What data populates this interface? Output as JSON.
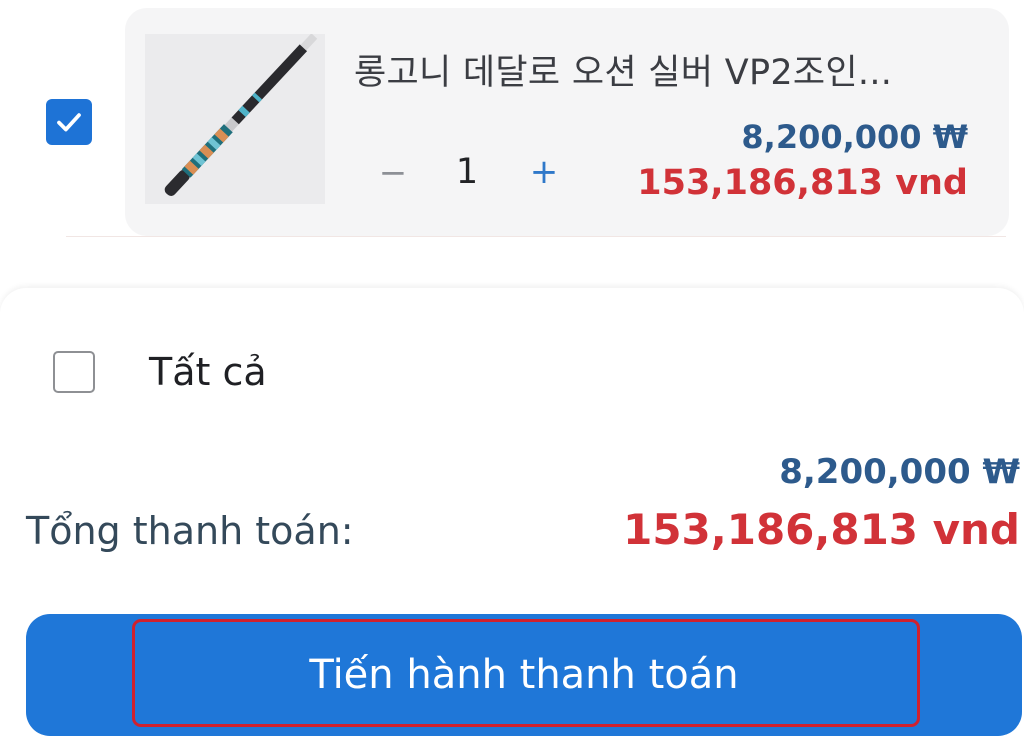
{
  "cart_item": {
    "checked": true,
    "product_name": "롱고니 데달로 오션 실버 VP2조인...",
    "quantity": "1",
    "minus_label": "−",
    "plus_label": "+",
    "price_krw": "8,200,000 ₩",
    "price_vnd": "153,186,813 vnd"
  },
  "summary": {
    "select_all_checked": false,
    "select_all_label": "Tất cả",
    "total_label": "Tổng thanh toán:",
    "total_krw": "8,200,000 ₩",
    "total_vnd": "153,186,813 vnd",
    "checkout_label": "Tiến hành thanh toán"
  },
  "icons": {
    "item_checkbox": "checkmark-icon",
    "product_image": "billiard-cue-image"
  },
  "colors": {
    "accent_blue": "#1f77d8",
    "price_krw": "#2d5a8c",
    "price_vnd": "#d13238",
    "highlight_border": "#d0212e"
  }
}
